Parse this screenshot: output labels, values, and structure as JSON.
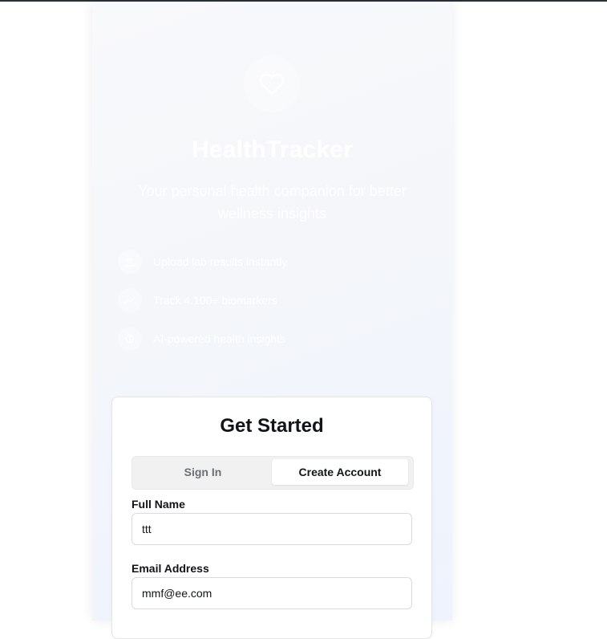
{
  "brand": {
    "name": "HealthTracker",
    "tagline": "Your personal health companion for better wellness insights"
  },
  "features": [
    {
      "icon": "upload-icon",
      "text": "Upload lab results instantly"
    },
    {
      "icon": "trend-icon",
      "text": "Track 4,100+ biomarkers"
    },
    {
      "icon": "brain-icon",
      "text": "AI-powered health insights"
    }
  ],
  "auth": {
    "title": "Get Started",
    "tabs": {
      "signin": "Sign In",
      "create": "Create Account"
    },
    "active_tab": "create",
    "full_name": {
      "label": "Full Name",
      "value": "ttt"
    },
    "email": {
      "label": "Email Address",
      "value": "mmf@ee.com"
    }
  },
  "colors": {
    "accent": "#ffffff",
    "card_border": "#e3e5e8",
    "tab_bg": "#f1f1f1"
  }
}
